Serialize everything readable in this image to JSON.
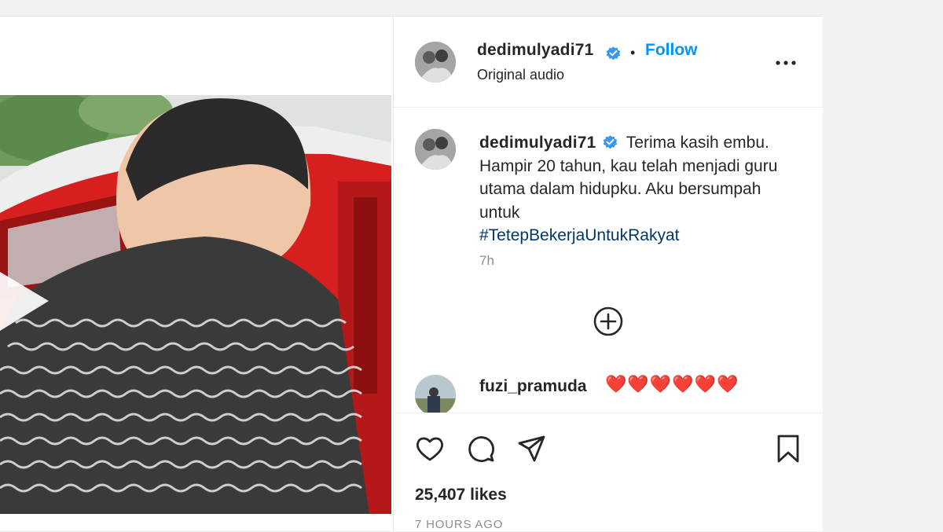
{
  "header": {
    "username": "dedimulyadi71",
    "separator": "•",
    "follow_label": "Follow",
    "audio_label": "Original audio",
    "more_icon": "more-horizontal-icon"
  },
  "caption": {
    "username": "dedimulyadi71",
    "text": "Terima kasih embu. Hampir 20 tahun, kau telah menjadi guru utama dalam hidupku. Aku bersumpah untuk",
    "hashtag": "#TetepBekerjaUntukRakyat",
    "time": "7h"
  },
  "load_more_icon": "plus-circle-icon",
  "comment": {
    "username": "fuzi_pramuda",
    "text": "❤️❤️❤️❤️❤️❤️"
  },
  "actions": {
    "like_icon": "heart-icon",
    "comment_icon": "comment-icon",
    "share_icon": "send-icon",
    "save_icon": "bookmark-icon"
  },
  "likes_text": "25,407 likes",
  "posted_time": "7 HOURS AGO",
  "colors": {
    "link_blue": "#0095f6",
    "hashtag_blue": "#00376b",
    "verified_blue": "#3897f0",
    "text": "#262626",
    "secondary_text": "#8e8e8e"
  }
}
